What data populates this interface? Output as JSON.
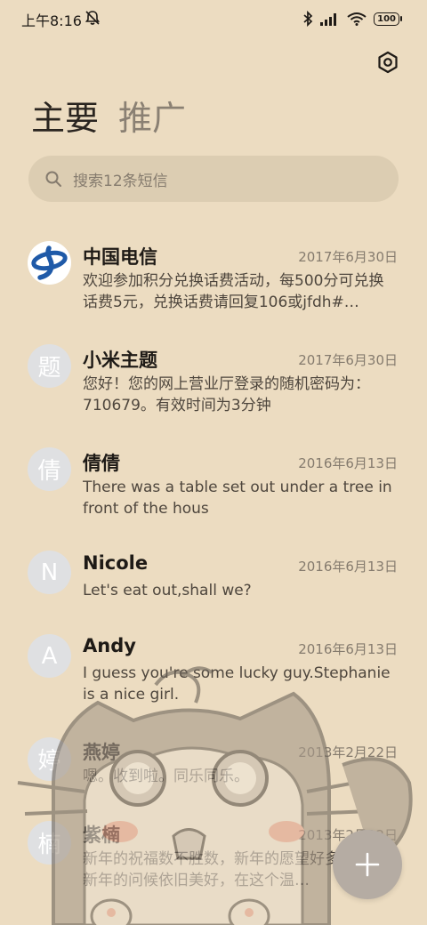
{
  "status_bar": {
    "time": "上午8:16",
    "battery": "100"
  },
  "tabs": [
    {
      "label": "主要",
      "active": true
    },
    {
      "label": "推广",
      "active": false
    }
  ],
  "search": {
    "placeholder": "搜索12条短信"
  },
  "conversations": [
    {
      "name": "中国电信",
      "date": "2017年6月30日",
      "preview": "欢迎参加积分兑换话费活动，每500分可兑换话费5元，兑换话费请回复106或jfdh#…",
      "avatar": "",
      "avatar_icon": "china-telecom-logo"
    },
    {
      "name": "小米主题",
      "date": "2017年6月30日",
      "preview": "您好！您的网上营业厅登录的随机密码为：710679。有效时间为3分钟",
      "avatar": "题"
    },
    {
      "name": "倩倩",
      "date": "2016年6月13日",
      "preview": "There was a table set out under a tree in front of the hous",
      "avatar": "倩"
    },
    {
      "name": "Nicole",
      "date": "2016年6月13日",
      "preview": "Let's eat out,shall we?",
      "avatar": "N"
    },
    {
      "name": "Andy",
      "date": "2016年6月13日",
      "preview": "I guess you're some lucky guy.Stephanie is a nice girl.",
      "avatar": "A"
    },
    {
      "name": "燕婷",
      "date": "2013年2月22日",
      "preview": "嗯。收到啦。同乐同乐。",
      "avatar": "婷"
    },
    {
      "name": "紫楠",
      "date": "2013年2月22日",
      "preview": "新年的祝福数不胜数，新年的愿望好多好多，新年的问候依旧美好，在这个温…",
      "avatar": "楠"
    }
  ],
  "colors": {
    "background": "#ecdcc1",
    "search_bg": "#dccdb2",
    "fab_bg": "#b5aca3",
    "telecom_blue": "#1f5aa8"
  }
}
